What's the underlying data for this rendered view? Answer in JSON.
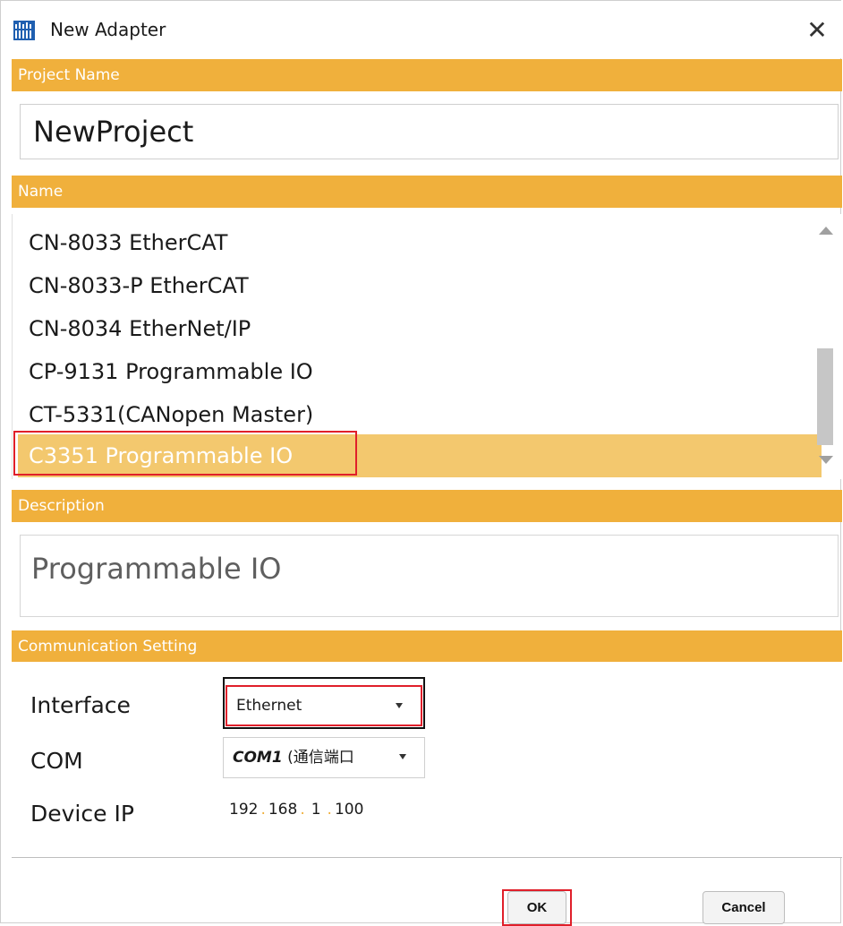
{
  "window": {
    "title": "New Adapter",
    "close_glyph": "✕",
    "icon": "adapter-app-icon"
  },
  "project": {
    "header": "Project Name",
    "value": "NewProject"
  },
  "name": {
    "header": "Name",
    "items": [
      {
        "label": "CN-8033 EtherCAT"
      },
      {
        "label": "CN-8033-P EtherCAT"
      },
      {
        "label": "CN-8034 EtherNet/IP"
      },
      {
        "label": "CP-9131 Programmable IO"
      },
      {
        "label": "CT-5331(CANopen Master)"
      },
      {
        "label": "C3351 Programmable IO"
      }
    ],
    "selected_index": 5
  },
  "description": {
    "header": "Description",
    "value": "Programmable IO"
  },
  "communication": {
    "header": "Communication Setting",
    "interface_label": "Interface",
    "interface_value": "Ethernet",
    "com_label": "COM",
    "com_value_bold": "COM1",
    "com_value_rest": " (通信端口",
    "device_ip_label": "Device IP",
    "ip": [
      "192",
      "168",
      "1",
      "100"
    ]
  },
  "buttons": {
    "ok": "OK",
    "cancel": "Cancel"
  },
  "colors": {
    "accent": "#f0b03c",
    "selection": "#f3c86e",
    "highlight_outline": "#e01f2a"
  }
}
